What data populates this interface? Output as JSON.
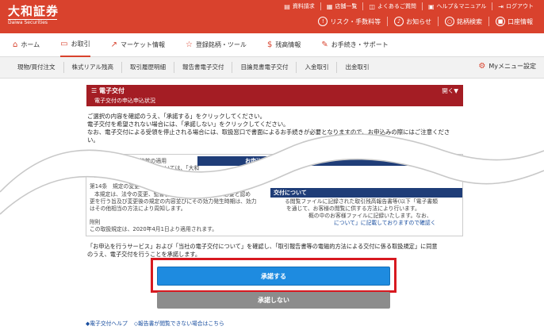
{
  "header": {
    "logo_main": "大和証券",
    "logo_sub": "Daiwa Securities",
    "util_links": [
      {
        "label": "資料請求",
        "icon": "document-icon"
      },
      {
        "label": "店舗一覧",
        "icon": "store-icon"
      },
      {
        "label": "よくあるご質問",
        "icon": "faq-icon"
      },
      {
        "label": "ヘルプ＆マニュアル",
        "icon": "help-icon"
      },
      {
        "label": "ログアウト",
        "icon": "logout-icon"
      }
    ],
    "actions": [
      {
        "label": "リスク・手数料等",
        "icon": "info-icon"
      },
      {
        "label": "お知らせ",
        "icon": "bell-icon"
      },
      {
        "label": "銘柄検索",
        "icon": "search-icon"
      },
      {
        "label": "口座情報",
        "icon": "account-icon"
      }
    ]
  },
  "gnav": [
    {
      "label": "ホーム",
      "icon": "home-icon"
    },
    {
      "label": "お取引",
      "icon": "trade-icon"
    },
    {
      "label": "マーケット情報",
      "icon": "market-icon"
    },
    {
      "label": "登録銘柄・ツール",
      "icon": "star-icon"
    },
    {
      "label": "残高情報",
      "icon": "yen-icon"
    },
    {
      "label": "お手続き・サポート",
      "icon": "pen-icon"
    }
  ],
  "snav": [
    "現物/買付注文",
    "株式リアル残高",
    "取引履歴明細",
    "報告書電子交付",
    "目論見書電子交付",
    "入金取引",
    "出金取引"
  ],
  "snav_my": "Myメニュー設定",
  "section": {
    "title": "電子交付",
    "subtitle": "電子交付の申込申込状況",
    "open": "開く▼"
  },
  "instructions": [
    "ご選択の内容を確認のうえ、「承諾する」をクリックしてください。",
    "電子交付を希望されない場合には、「承諾しない」をクリックしてください。",
    "なお、電子交付による受領を停止される場合には、取扱窓口で書面によるお手続きが必要となりますので、お申込みの際にはご注意くださ",
    "い。"
  ],
  "terms": {
    "bar_service": "お申込を行うサービス",
    "bar_about": "交付について",
    "lines": [
      "第13条　他の規定、約款の適用",
      "本規定に定めのない事項については、「大和",
      "約款・契約により取扱います。",
      "第14条　規定の変更",
      "本規定は、法令の変更、監督官庁の指示、又は当社が必要と認め",
      "更を行う旨及び変更後の規定の内容並びにその効力発生時期は、効力",
      "はその他相当の方法により周知します。",
      "附則",
      "この取扱規定は、2020年4月1日より適用されます。"
    ],
    "right_lines": [
      "る閲覧ファイルに記録された取引残高報告書等(以下「電子書類",
      "を通じて、お客様の閲覧に供する方法により行います。",
      "概の中のお客様ファイルに記録いたします。なお、",
      "について」に記載しておりますので確認く"
    ]
  },
  "agreement": [
    "「お申込を行うサービス」および「当社の電子交付について」を確認し、「取引報告書等の電磁的方法による交付に係る取扱規定」に同意",
    "のうえ、電子交付を行うことを承諾します。"
  ],
  "buttons": {
    "accept": "承諾する",
    "reject": "承諾しない"
  },
  "footer_links": [
    "◆電子交付ヘルプ",
    "◇報告書が閲覧できない場合はこちら"
  ],
  "colors": {
    "header_red": "#d9422d",
    "section_red": "#a41d24",
    "terms_navy": "#1f3d78",
    "accept_blue": "#1e8be0",
    "reject_gray": "#8c8c8c",
    "highlight_red": "#d71920"
  }
}
